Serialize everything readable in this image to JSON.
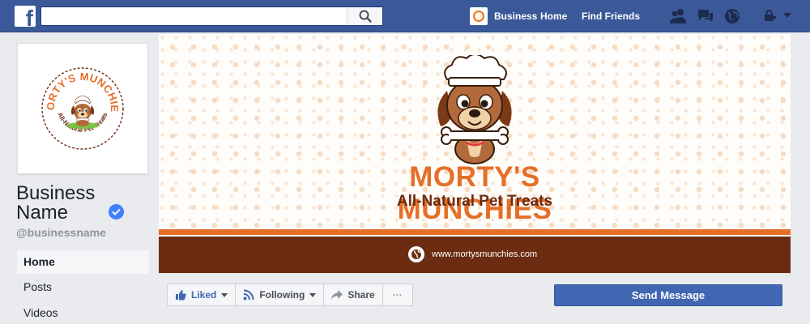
{
  "topbar": {
    "logo_letter": "f",
    "search": {
      "value": "",
      "placeholder": ""
    },
    "profile_label": "Business",
    "home_label": "Home",
    "find_friends_label": "Find Friends",
    "icons": [
      "friend-requests-icon",
      "messages-icon",
      "notifications-globe-icon",
      "lock-icon",
      "chevron-down-icon"
    ]
  },
  "page": {
    "name": "Business Name",
    "handle": "@businessname",
    "verified": true
  },
  "sidebar": {
    "items": [
      {
        "label": "Home",
        "active": true
      },
      {
        "label": "Posts",
        "active": false
      },
      {
        "label": "Videos",
        "active": false
      }
    ]
  },
  "cover": {
    "brand_name": "MORTY'S MUNCHIES",
    "tagline": "All-Natural Pet Treats",
    "website": "www.mortysmunchies.com"
  },
  "profile_logo": {
    "arc_text_top": "MORTY'S MUNCHIES",
    "arc_text_bottom": "All-Natural Pet Treats"
  },
  "actions": {
    "liked_label": "Liked",
    "following_label": "Following",
    "share_label": "Share",
    "more_label": "···",
    "send_message_label": "Send Message"
  },
  "colors": {
    "facebook_blue": "#3b5998",
    "button_blue": "#4267b2",
    "brand_orange": "#e56f28",
    "brand_brown": "#6c2c11",
    "verified_blue": "#4080ff"
  }
}
